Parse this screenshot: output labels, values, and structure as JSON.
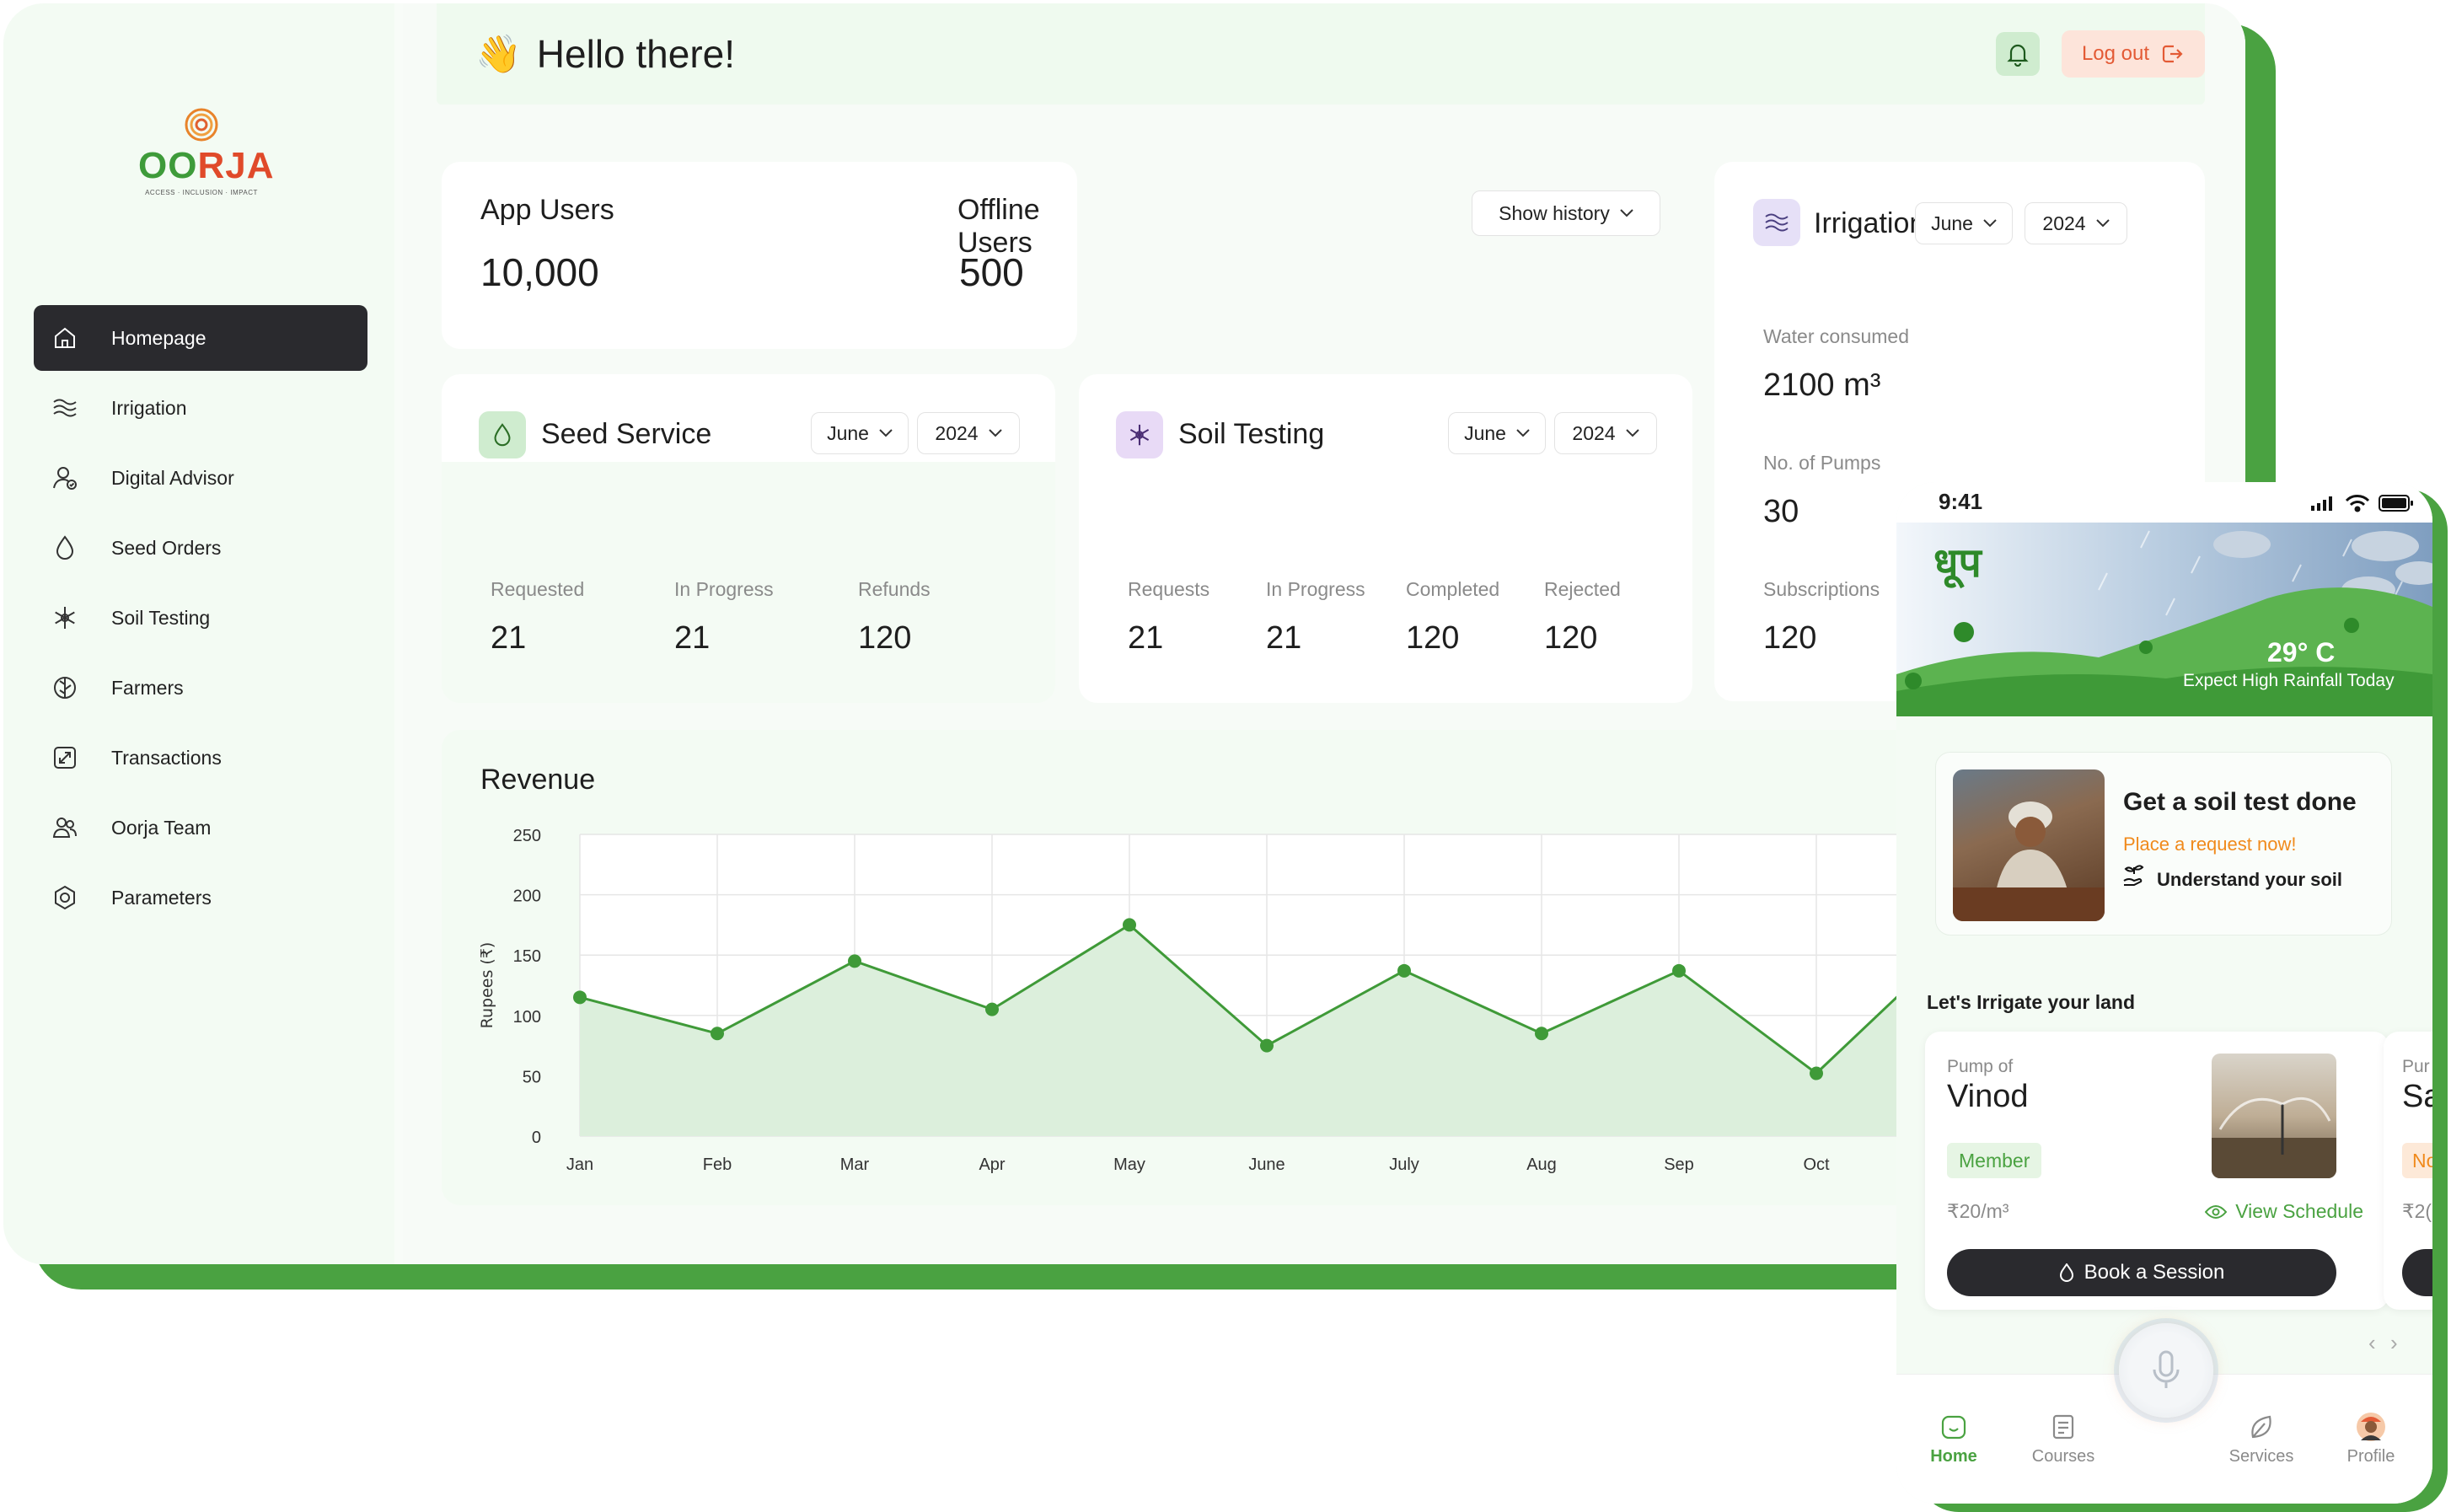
{
  "brand": {
    "logo_text_1": "OO",
    "logo_text_2": "RJA",
    "tagline": "ACCESS · INCLUSION · IMPACT"
  },
  "sidebar": {
    "items": [
      {
        "label": "Homepage",
        "icon": "home-icon",
        "active": true
      },
      {
        "label": "Irrigation",
        "icon": "waves-icon"
      },
      {
        "label": "Digital Advisor",
        "icon": "advisor-icon"
      },
      {
        "label": "Seed Orders",
        "icon": "drop-icon"
      },
      {
        "label": "Soil Testing",
        "icon": "snowflake-icon"
      },
      {
        "label": "Farmers",
        "icon": "leaf-icon"
      },
      {
        "label": "Transactions",
        "icon": "transactions-icon"
      },
      {
        "label": "Oorja Team",
        "icon": "team-icon"
      },
      {
        "label": "Parameters",
        "icon": "settings-icon"
      }
    ]
  },
  "header": {
    "wave": "👋",
    "greeting": "Hello there!",
    "logout_label": "Log out"
  },
  "users": {
    "app_users_label": "App Users",
    "app_users_value": "10,000",
    "offline_users_label": "Offline Users",
    "offline_users_value": "500",
    "history_label": "Show history"
  },
  "irrigation": {
    "title": "Irrigation",
    "month": "June",
    "year": "2024",
    "water_label": "Water consumed",
    "water_value": "2100 m³",
    "pumps_label": "No. of Pumps",
    "pumps_value": "30",
    "subs_label": "Subscriptions",
    "subs_value": "120"
  },
  "seed_service": {
    "title": "Seed Service",
    "month": "June",
    "year": "2024",
    "stats": [
      {
        "label": "Requested",
        "value": "21"
      },
      {
        "label": "In Progress",
        "value": "21"
      },
      {
        "label": "Refunds",
        "value": "120"
      }
    ]
  },
  "soil_testing": {
    "title": "Soil Testing",
    "month": "June",
    "year": "2024",
    "stats": [
      {
        "label": "Requests",
        "value": "21"
      },
      {
        "label": "In Progress",
        "value": "21"
      },
      {
        "label": "Completed",
        "value": "120"
      },
      {
        "label": "Rejected",
        "value": "120"
      }
    ]
  },
  "revenue": {
    "title": "Revenue",
    "chart_data": {
      "type": "area",
      "title": "Revenue",
      "ylabel": "Rupees (₹)",
      "xlabel": "",
      "ylim": [
        0,
        250
      ],
      "yticks": [
        0,
        50,
        100,
        150,
        200,
        250
      ],
      "categories": [
        "Jan",
        "Feb",
        "Mar",
        "Apr",
        "May",
        "June",
        "July",
        "Aug",
        "Sep",
        "Oct"
      ],
      "values": [
        115,
        85,
        145,
        105,
        175,
        75,
        137,
        85,
        137,
        52
      ],
      "grid": true,
      "color": "#3f9a38",
      "fill": "#dcefdc"
    }
  },
  "phone": {
    "time": "9:41",
    "weather_word": "धूप",
    "temperature": "29° C",
    "forecast": "Expect High Rainfall Today",
    "soil_card": {
      "title": "Get a soil test done",
      "cta": "Place a request now!",
      "sub": "Understand your soil"
    },
    "irrigate_title": "Let's Irrigate your land",
    "pump": {
      "prefix": "Pump of",
      "name": "Vinod",
      "badge": "Member",
      "rate": "₹20/m³",
      "schedule": "View Schedule",
      "book": "Book a Session"
    },
    "pump2": {
      "prefix": "Pur",
      "name": "Sa",
      "badge": "No",
      "rate": "₹2("
    },
    "nav": [
      {
        "label": "Home",
        "active": true
      },
      {
        "label": "Courses"
      },
      {
        "label": "Services"
      },
      {
        "label": "Profile"
      }
    ]
  },
  "colors": {
    "accent": "#4aa241",
    "dark": "#2a2a2e",
    "orange": "#e35a35",
    "light_green": "#effaef"
  }
}
